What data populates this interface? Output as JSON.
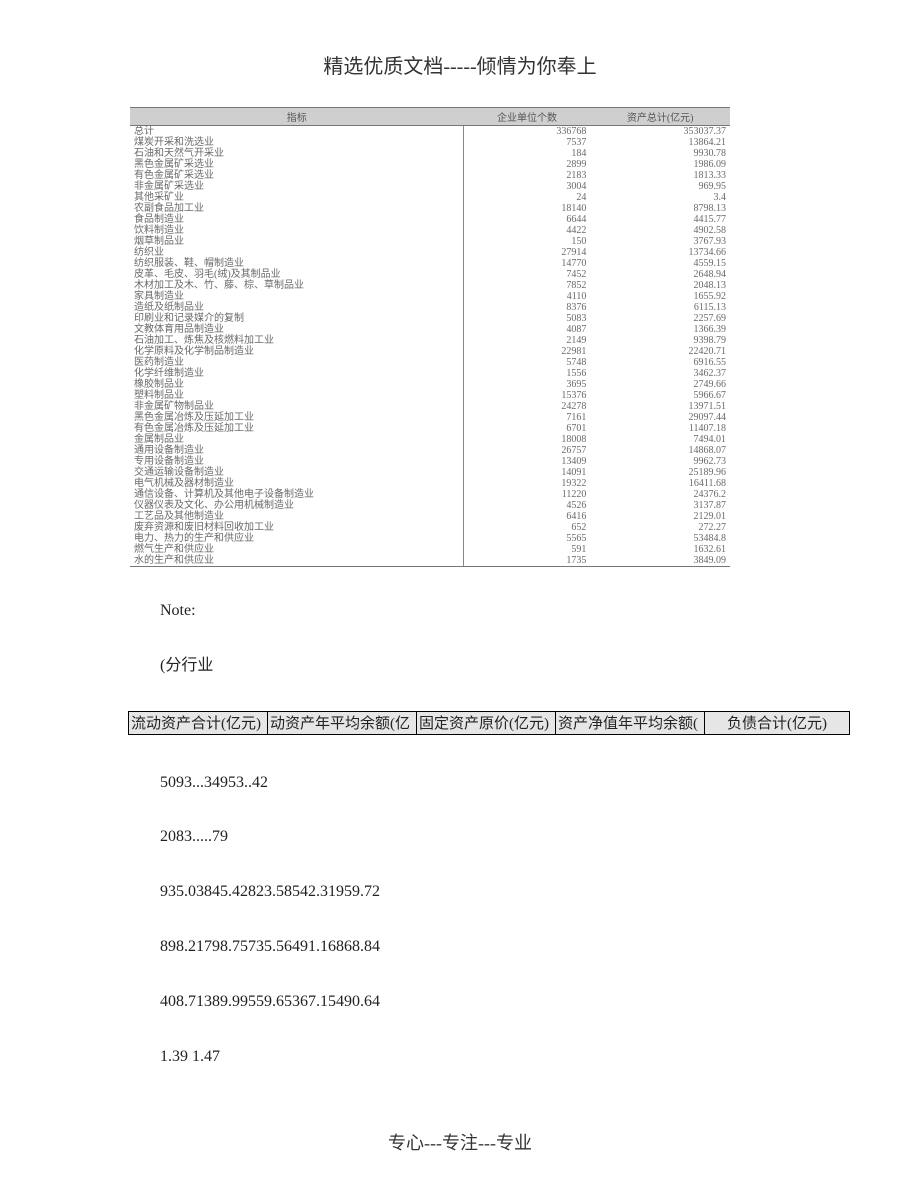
{
  "header": "精选优质文档-----倾情为你奉上",
  "footer": "专心---专注---专业",
  "table": {
    "headers": {
      "indicator": "指标",
      "col1": "企业单位个数",
      "col2": "资产总计(亿元)"
    },
    "rows": [
      {
        "name": "总计",
        "c1": "336768",
        "c2": "353037.37"
      },
      {
        "name": "煤炭开采和洗选业",
        "c1": "7537",
        "c2": "13864.21"
      },
      {
        "name": "石油和天然气开采业",
        "c1": "184",
        "c2": "9930.78"
      },
      {
        "name": "黑色金属矿采选业",
        "c1": "2899",
        "c2": "1986.09"
      },
      {
        "name": "有色金属矿采选业",
        "c1": "2183",
        "c2": "1813.33"
      },
      {
        "name": "非金属矿采选业",
        "c1": "3004",
        "c2": "969.95"
      },
      {
        "name": "其他采矿业",
        "c1": "24",
        "c2": "3.4"
      },
      {
        "name": "农副食品加工业",
        "c1": "18140",
        "c2": "8798.13"
      },
      {
        "name": "食品制造业",
        "c1": "6644",
        "c2": "4415.77"
      },
      {
        "name": "饮料制造业",
        "c1": "4422",
        "c2": "4902.58"
      },
      {
        "name": "烟草制品业",
        "c1": "150",
        "c2": "3767.93"
      },
      {
        "name": "纺织业",
        "c1": "27914",
        "c2": "13734.66"
      },
      {
        "name": "纺织服装、鞋、帽制造业",
        "c1": "14770",
        "c2": "4559.15"
      },
      {
        "name": "皮革、毛皮、羽毛(绒)及其制品业",
        "c1": "7452",
        "c2": "2648.94"
      },
      {
        "name": "木材加工及木、竹、藤、棕、草制品业",
        "c1": "7852",
        "c2": "2048.13"
      },
      {
        "name": "家具制造业",
        "c1": "4110",
        "c2": "1655.92"
      },
      {
        "name": "造纸及纸制品业",
        "c1": "8376",
        "c2": "6115.13"
      },
      {
        "name": "印刷业和记录媒介的复制",
        "c1": "5083",
        "c2": "2257.69"
      },
      {
        "name": "文教体育用品制造业",
        "c1": "4087",
        "c2": "1366.39"
      },
      {
        "name": "石油加工、炼焦及核燃料加工业",
        "c1": "2149",
        "c2": "9398.79"
      },
      {
        "name": "化学原料及化学制品制造业",
        "c1": "22981",
        "c2": "22420.71"
      },
      {
        "name": "医药制造业",
        "c1": "5748",
        "c2": "6916.55"
      },
      {
        "name": "化学纤维制造业",
        "c1": "1556",
        "c2": "3462.37"
      },
      {
        "name": "橡胶制品业",
        "c1": "3695",
        "c2": "2749.66"
      },
      {
        "name": "塑料制品业",
        "c1": "15376",
        "c2": "5966.67"
      },
      {
        "name": "非金属矿物制品业",
        "c1": "24278",
        "c2": "13971.51"
      },
      {
        "name": "黑色金属冶炼及压延加工业",
        "c1": "7161",
        "c2": "29097.44"
      },
      {
        "name": "有色金属冶炼及压延加工业",
        "c1": "6701",
        "c2": "11407.18"
      },
      {
        "name": "金属制品业",
        "c1": "18008",
        "c2": "7494.01"
      },
      {
        "name": "通用设备制造业",
        "c1": "26757",
        "c2": "14868.07"
      },
      {
        "name": "专用设备制造业",
        "c1": "13409",
        "c2": "9962.73"
      },
      {
        "name": "交通运输设备制造业",
        "c1": "14091",
        "c2": "25189.96"
      },
      {
        "name": "电气机械及器材制造业",
        "c1": "19322",
        "c2": "16411.68"
      },
      {
        "name": "通信设备、计算机及其他电子设备制造业",
        "c1": "11220",
        "c2": "24376.2"
      },
      {
        "name": "仪器仪表及文化、办公用机械制造业",
        "c1": "4526",
        "c2": "3137.87"
      },
      {
        "name": "工艺品及其他制造业",
        "c1": "6416",
        "c2": "2129.01"
      },
      {
        "name": "废弃资源和废旧材料回收加工业",
        "c1": "652",
        "c2": "272.27"
      },
      {
        "name": "电力、热力的生产和供应业",
        "c1": "5565",
        "c2": "53484.8"
      },
      {
        "name": "燃气生产和供应业",
        "c1": "591",
        "c2": "1632.61"
      },
      {
        "name": "水的生产和供应业",
        "c1": "1735",
        "c2": "3849.09"
      }
    ]
  },
  "note_label": "Note:",
  "subnote": "(分行业",
  "band": {
    "c0": "流动资产合计(亿元)",
    "c1": "动资产年平均余额(亿",
    "c2": "固定资产原价(亿元)",
    "c3": "资产净值年平均余额(",
    "c4": "负债合计(亿元)"
  },
  "lines": [
    "5093...34953..42",
    "2083.....79",
    "935.03845.42823.58542.31959.72",
    "898.21798.75735.56491.16868.84",
    "408.71389.99559.65367.15490.64",
    "1.39 1.47"
  ],
  "chart_data": {
    "type": "table",
    "title": "分行业企业单位个数与资产总计",
    "columns": [
      "指标",
      "企业单位个数",
      "资产总计(亿元)"
    ],
    "rows": [
      [
        "总计",
        336768,
        353037.37
      ],
      [
        "煤炭开采和洗选业",
        7537,
        13864.21
      ],
      [
        "石油和天然气开采业",
        184,
        9930.78
      ],
      [
        "黑色金属矿采选业",
        2899,
        1986.09
      ],
      [
        "有色金属矿采选业",
        2183,
        1813.33
      ],
      [
        "非金属矿采选业",
        3004,
        969.95
      ],
      [
        "其他采矿业",
        24,
        3.4
      ],
      [
        "农副食品加工业",
        18140,
        8798.13
      ],
      [
        "食品制造业",
        6644,
        4415.77
      ],
      [
        "饮料制造业",
        4422,
        4902.58
      ],
      [
        "烟草制品业",
        150,
        3767.93
      ],
      [
        "纺织业",
        27914,
        13734.66
      ],
      [
        "纺织服装、鞋、帽制造业",
        14770,
        4559.15
      ],
      [
        "皮革、毛皮、羽毛(绒)及其制品业",
        7452,
        2648.94
      ],
      [
        "木材加工及木、竹、藤、棕、草制品业",
        7852,
        2048.13
      ],
      [
        "家具制造业",
        4110,
        1655.92
      ],
      [
        "造纸及纸制品业",
        8376,
        6115.13
      ],
      [
        "印刷业和记录媒介的复制",
        5083,
        2257.69
      ],
      [
        "文教体育用品制造业",
        4087,
        1366.39
      ],
      [
        "石油加工、炼焦及核燃料加工业",
        2149,
        9398.79
      ],
      [
        "化学原料及化学制品制造业",
        22981,
        22420.71
      ],
      [
        "医药制造业",
        5748,
        6916.55
      ],
      [
        "化学纤维制造业",
        1556,
        3462.37
      ],
      [
        "橡胶制品业",
        3695,
        2749.66
      ],
      [
        "塑料制品业",
        15376,
        5966.67
      ],
      [
        "非金属矿物制品业",
        24278,
        13971.51
      ],
      [
        "黑色金属冶炼及压延加工业",
        7161,
        29097.44
      ],
      [
        "有色金属冶炼及压延加工业",
        6701,
        11407.18
      ],
      [
        "金属制品业",
        18008,
        7494.01
      ],
      [
        "通用设备制造业",
        26757,
        14868.07
      ],
      [
        "专用设备制造业",
        13409,
        9962.73
      ],
      [
        "交通运输设备制造业",
        14091,
        25189.96
      ],
      [
        "电气机械及器材制造业",
        19322,
        16411.68
      ],
      [
        "通信设备、计算机及其他电子设备制造业",
        11220,
        24376.2
      ],
      [
        "仪器仪表及文化、办公用机械制造业",
        4526,
        3137.87
      ],
      [
        "工艺品及其他制造业",
        6416,
        2129.01
      ],
      [
        "废弃资源和废旧材料回收加工业",
        652,
        272.27
      ],
      [
        "电力、热力的生产和供应业",
        5565,
        53484.8
      ],
      [
        "燃气生产和供应业",
        591,
        1632.61
      ],
      [
        "水的生产和供应业",
        1735,
        3849.09
      ]
    ]
  }
}
